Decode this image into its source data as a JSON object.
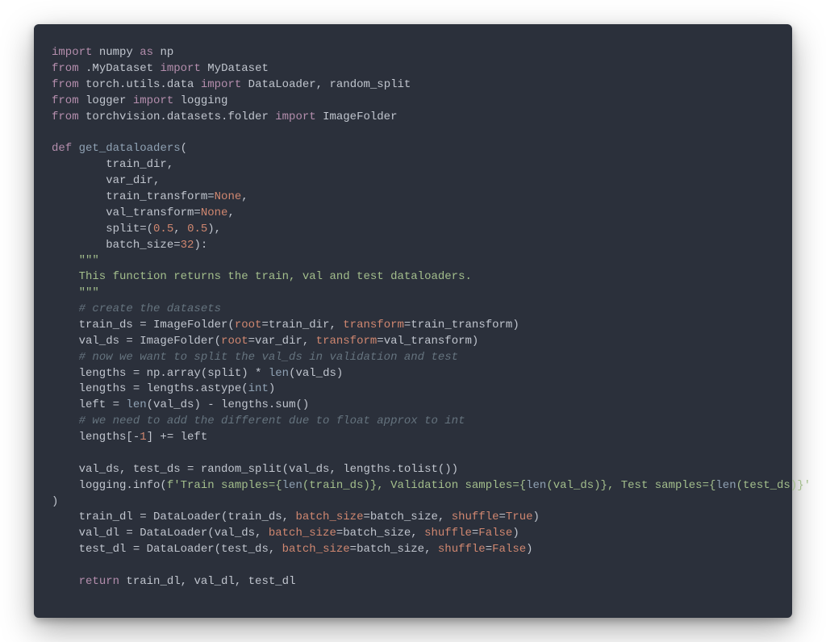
{
  "code": {
    "tokens": [
      [
        [
          "keyword",
          "import"
        ],
        [
          "plain",
          " numpy "
        ],
        [
          "keyword",
          "as"
        ],
        [
          "plain",
          " np"
        ]
      ],
      [
        [
          "keyword",
          "from"
        ],
        [
          "plain",
          " .MyDataset "
        ],
        [
          "keyword",
          "import"
        ],
        [
          "plain",
          " MyDataset"
        ]
      ],
      [
        [
          "keyword",
          "from"
        ],
        [
          "plain",
          " torch.utils.data "
        ],
        [
          "keyword",
          "import"
        ],
        [
          "plain",
          " DataLoader, random_split"
        ]
      ],
      [
        [
          "keyword",
          "from"
        ],
        [
          "plain",
          " logger "
        ],
        [
          "keyword",
          "import"
        ],
        [
          "plain",
          " logging"
        ]
      ],
      [
        [
          "keyword",
          "from"
        ],
        [
          "plain",
          " torchvision.datasets.folder "
        ],
        [
          "keyword",
          "import"
        ],
        [
          "plain",
          " ImageFolder"
        ]
      ],
      [],
      [
        [
          "keyword",
          "def"
        ],
        [
          "plain",
          " "
        ],
        [
          "funcname",
          "get_dataloaders"
        ],
        [
          "plain",
          "("
        ]
      ],
      [
        [
          "plain",
          "        train_dir,"
        ]
      ],
      [
        [
          "plain",
          "        var_dir,"
        ]
      ],
      [
        [
          "plain",
          "        train_transform="
        ],
        [
          "const",
          "None"
        ],
        [
          "plain",
          ","
        ]
      ],
      [
        [
          "plain",
          "        val_transform="
        ],
        [
          "const",
          "None"
        ],
        [
          "plain",
          ","
        ]
      ],
      [
        [
          "plain",
          "        split=("
        ],
        [
          "number",
          "0.5"
        ],
        [
          "plain",
          ", "
        ],
        [
          "number",
          "0.5"
        ],
        [
          "plain",
          "),"
        ]
      ],
      [
        [
          "plain",
          "        batch_size="
        ],
        [
          "number",
          "32"
        ],
        [
          "plain",
          "):"
        ]
      ],
      [
        [
          "plain",
          "    "
        ],
        [
          "string",
          "\"\"\""
        ]
      ],
      [
        [
          "string",
          "    This function returns the train, val and test dataloaders."
        ]
      ],
      [
        [
          "string",
          "    \"\"\""
        ]
      ],
      [
        [
          "plain",
          "    "
        ],
        [
          "comment",
          "# create the datasets"
        ]
      ],
      [
        [
          "plain",
          "    train_ds = ImageFolder("
        ],
        [
          "param",
          "root"
        ],
        [
          "plain",
          "=train_dir, "
        ],
        [
          "param",
          "transform"
        ],
        [
          "plain",
          "=train_transform)"
        ]
      ],
      [
        [
          "plain",
          "    val_ds = ImageFolder("
        ],
        [
          "param",
          "root"
        ],
        [
          "plain",
          "=var_dir, "
        ],
        [
          "param",
          "transform"
        ],
        [
          "plain",
          "=val_transform)"
        ]
      ],
      [
        [
          "plain",
          "    "
        ],
        [
          "comment",
          "# now we want to split the val_ds in validation and test"
        ]
      ],
      [
        [
          "plain",
          "    lengths = np.array(split) * "
        ],
        [
          "builtin",
          "len"
        ],
        [
          "plain",
          "(val_ds)"
        ]
      ],
      [
        [
          "plain",
          "    lengths = lengths.astype("
        ],
        [
          "builtin",
          "int"
        ],
        [
          "plain",
          ")"
        ]
      ],
      [
        [
          "plain",
          "    left = "
        ],
        [
          "builtin",
          "len"
        ],
        [
          "plain",
          "(val_ds) - lengths.sum()"
        ]
      ],
      [
        [
          "plain",
          "    "
        ],
        [
          "comment",
          "# we need to add the different due to float approx to int"
        ]
      ],
      [
        [
          "plain",
          "    lengths[-"
        ],
        [
          "number",
          "1"
        ],
        [
          "plain",
          "] += left"
        ]
      ],
      [],
      [
        [
          "plain",
          "    val_ds, test_ds = random_split(val_ds, lengths.tolist())"
        ]
      ],
      [
        [
          "plain",
          "    logging.info("
        ],
        [
          "string",
          "f'Train samples={"
        ],
        [
          "builtin",
          "len"
        ],
        [
          "string",
          "(train_ds)}, Validation samples={"
        ],
        [
          "builtin",
          "len"
        ],
        [
          "string",
          "(val_ds)}, Test samples={"
        ],
        [
          "builtin",
          "len"
        ],
        [
          "string",
          "(test_ds)}'"
        ]
      ],
      [
        [
          "plain",
          ")"
        ]
      ],
      [
        [
          "plain",
          "    train_dl = DataLoader(train_ds, "
        ],
        [
          "param",
          "batch_size"
        ],
        [
          "plain",
          "=batch_size, "
        ],
        [
          "param",
          "shuffle"
        ],
        [
          "plain",
          "="
        ],
        [
          "const",
          "True"
        ],
        [
          "plain",
          ")"
        ]
      ],
      [
        [
          "plain",
          "    val_dl = DataLoader(val_ds, "
        ],
        [
          "param",
          "batch_size"
        ],
        [
          "plain",
          "=batch_size, "
        ],
        [
          "param",
          "shuffle"
        ],
        [
          "plain",
          "="
        ],
        [
          "const",
          "False"
        ],
        [
          "plain",
          ")"
        ]
      ],
      [
        [
          "plain",
          "    test_dl = DataLoader(test_ds, "
        ],
        [
          "param",
          "batch_size"
        ],
        [
          "plain",
          "=batch_size, "
        ],
        [
          "param",
          "shuffle"
        ],
        [
          "plain",
          "="
        ],
        [
          "const",
          "False"
        ],
        [
          "plain",
          ")"
        ]
      ],
      [],
      [
        [
          "plain",
          "    "
        ],
        [
          "keyword",
          "return"
        ],
        [
          "plain",
          " train_dl, val_dl, test_dl"
        ]
      ]
    ]
  }
}
